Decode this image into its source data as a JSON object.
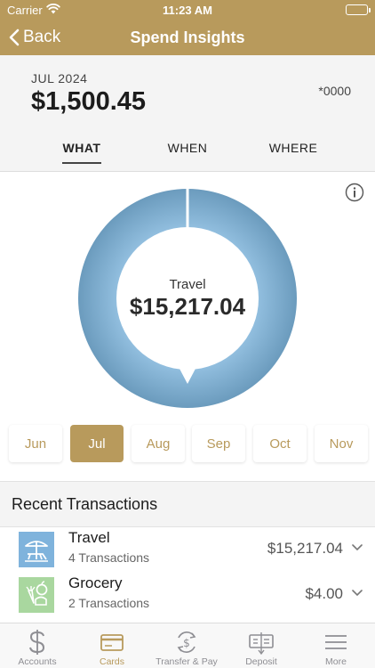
{
  "status_bar": {
    "carrier": "Carrier",
    "time": "11:23 AM"
  },
  "nav": {
    "back_label": "Back",
    "title": "Spend Insights"
  },
  "summary": {
    "month": "JUL 2024",
    "amount": "$1,500.45",
    "account": "*0000"
  },
  "tabs": [
    {
      "label": "WHAT",
      "active": true
    },
    {
      "label": "WHEN",
      "active": false
    },
    {
      "label": "WHERE",
      "active": false
    }
  ],
  "donut": {
    "category": "Travel",
    "value": "$15,217.04",
    "share": 1.0,
    "color": "#7faccc"
  },
  "months": [
    {
      "label": "Jun",
      "selected": false
    },
    {
      "label": "Jul",
      "selected": true
    },
    {
      "label": "Aug",
      "selected": false
    },
    {
      "label": "Sep",
      "selected": false
    },
    {
      "label": "Oct",
      "selected": false
    },
    {
      "label": "Nov",
      "selected": false
    }
  ],
  "recent": {
    "title": "Recent Transactions",
    "items": [
      {
        "name": "Travel",
        "count": "4 Transactions",
        "amount": "$15,217.04",
        "icon": "travel-icon",
        "icon_bg": "#7fb3dc"
      },
      {
        "name": "Grocery",
        "count": "2 Transactions",
        "amount": "$4.00",
        "icon": "grocery-icon",
        "icon_bg": "#a9d79f"
      }
    ]
  },
  "tabbar": [
    {
      "label": "Accounts",
      "icon": "dollar-icon",
      "active": false
    },
    {
      "label": "Cards",
      "icon": "card-icon",
      "active": true
    },
    {
      "label": "Transfer & Pay",
      "icon": "transfer-icon",
      "active": false
    },
    {
      "label": "Deposit",
      "icon": "check-deposit-icon",
      "active": false
    },
    {
      "label": "More",
      "icon": "menu-icon",
      "active": false
    }
  ],
  "colors": {
    "brand": "#b89a5c",
    "background_band": "#f4f4f4"
  }
}
